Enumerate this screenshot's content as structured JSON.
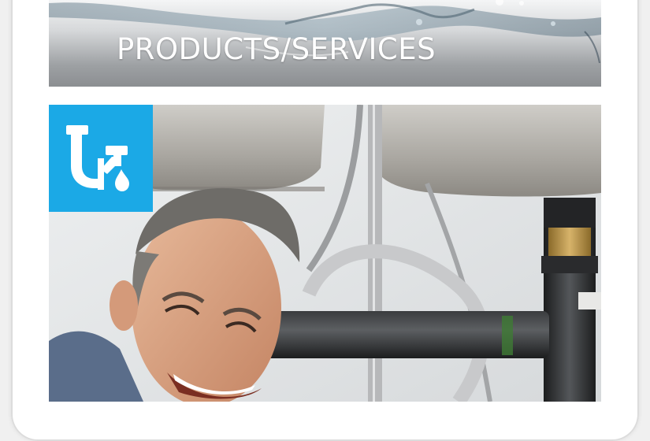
{
  "banner": {
    "title": "PRODUCTS/SERVICES"
  },
  "service_tile": {
    "icon": "plumbing-pipe-icon",
    "color": "#1ba9e6"
  },
  "hero": {
    "image": "plumber-under-sink-photo"
  }
}
